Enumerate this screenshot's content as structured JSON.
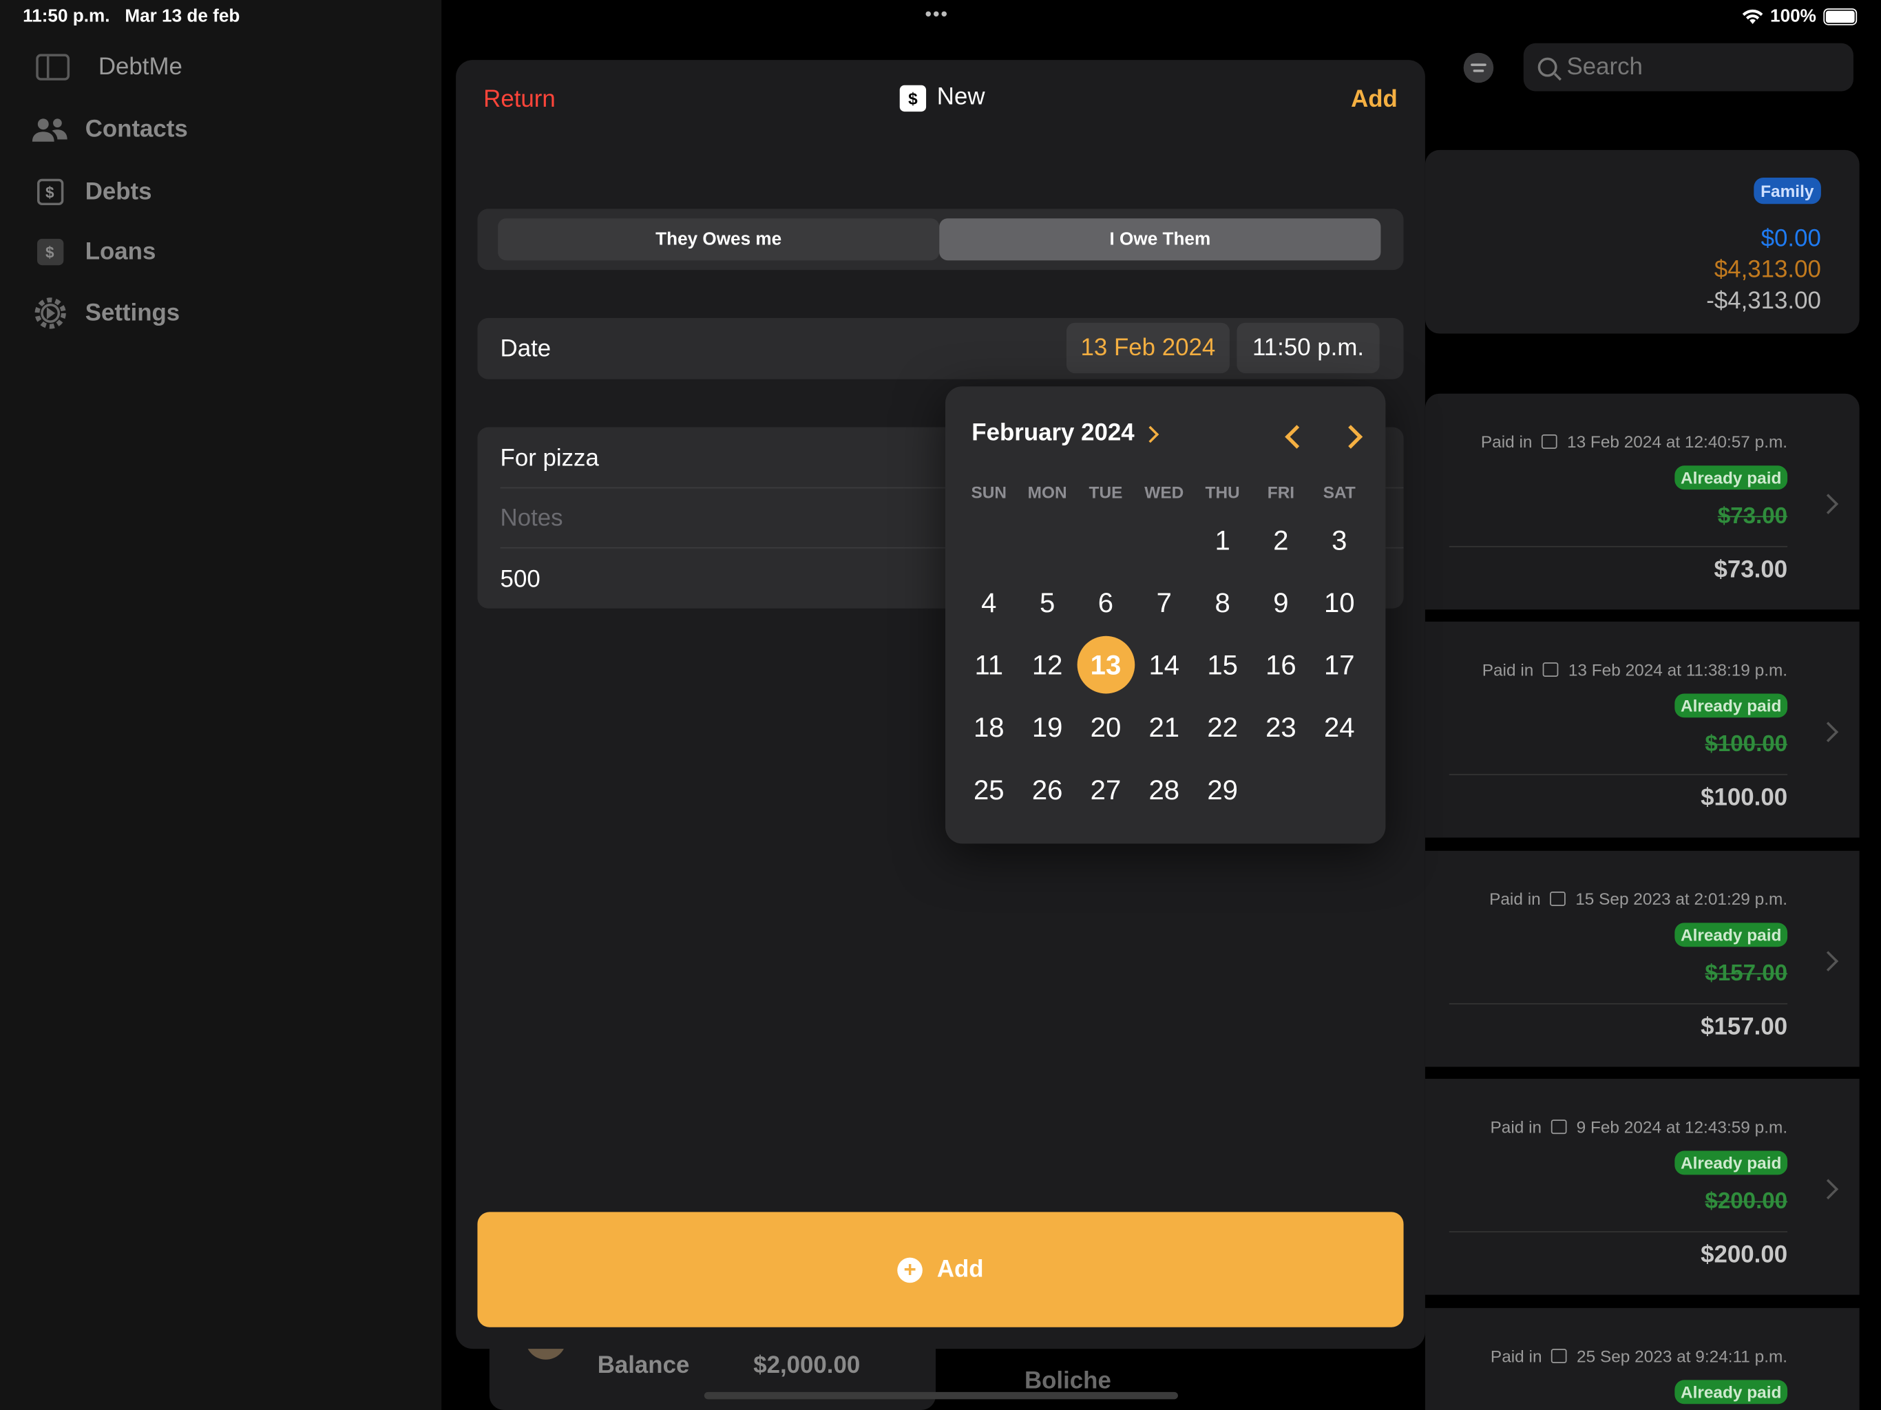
{
  "status": {
    "time": "11:50 p.m.",
    "date": "Mar 13 de feb",
    "battery": "100%"
  },
  "sidebar": {
    "title": "DebtMe",
    "items": [
      {
        "label": "Contacts",
        "icon": "people-icon"
      },
      {
        "label": "Debts",
        "icon": "dollar-icon"
      },
      {
        "label": "Loans",
        "icon": "dollar-icon"
      },
      {
        "label": "Settings",
        "icon": "gear-icon"
      }
    ]
  },
  "background": {
    "search_placeholder": "Search",
    "summary": {
      "badge": "Family",
      "amount_blue": "$0.00",
      "amount_orange": "$4,313.00",
      "amount_neg": "-$4,313.00"
    },
    "paid_label": "Paid in",
    "paid_badge": "Already paid",
    "payments": [
      {
        "date": "13 Feb 2024 at 12:40:57 p.m.",
        "struck": "$73.00",
        "total": "$73.00"
      },
      {
        "date": "13 Feb 2024 at 11:38:19 p.m.",
        "struck": "$100.00",
        "total": "$100.00"
      },
      {
        "date": "15 Sep 2023 at 2:01:29 p.m.",
        "struck": "$157.00",
        "total": "$157.00"
      },
      {
        "date": "9 Feb 2024 at 12:43:59 p.m.",
        "struck": "$200.00",
        "total": "$200.00"
      },
      {
        "date": "25 Sep 2023 at 9:24:11 p.m.",
        "struck": "",
        "total": ""
      }
    ],
    "bottom": {
      "balance_label": "Balance",
      "balance_value": "$2,000.00",
      "name": "Boliche"
    }
  },
  "modal": {
    "return_label": "Return",
    "title": "New",
    "add_label": "Add",
    "segments": [
      "They Owes me",
      "I Owe Them"
    ],
    "selected_segment": 1,
    "date_label": "Date",
    "date_value": "13 Feb 2024",
    "time_value": "11:50 p.m.",
    "title_value": "For pizza",
    "notes_placeholder": "Notes",
    "amount_value": "500",
    "add_button_label": "Add"
  },
  "picker": {
    "month_label": "February 2024",
    "weekdays": [
      "SUN",
      "MON",
      "TUE",
      "WED",
      "THU",
      "FRI",
      "SAT"
    ],
    "first_weekday_index": 4,
    "days_in_month": 29,
    "selected_day": 13
  },
  "colors": {
    "accent": "#f5b042",
    "return": "#ff453a",
    "paid": "#1e8a2e",
    "family": "#1a5bb8"
  }
}
